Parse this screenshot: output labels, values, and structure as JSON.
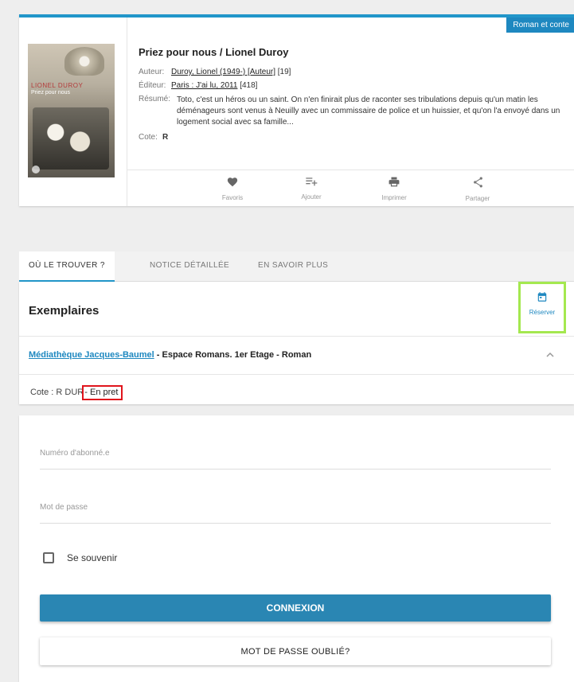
{
  "notice": {
    "genre_tag": "Roman et conte",
    "cover": {
      "author": "LIONEL DUROY",
      "title": "Priez pour nous"
    },
    "title": "Priez pour nous / Lionel Duroy",
    "author_label": "Auteur:",
    "author_value": "Duroy, Lionel (1949-) [Auteur]",
    "author_suffix": " [19]",
    "publisher_label": "Éditeur:",
    "publisher_value": "Paris : J'ai lu, 2011",
    "publisher_suffix": " [418]",
    "summary_label": "Résumé:",
    "summary": "Toto, c'est un héros ou un saint. On n'en finirait plus de raconter ses tribulations depuis qu'un matin les déménageurs sont venus à Neuilly avec un commissaire de police et un huissier, et qu'on l'a envoyé dans un logement social avec sa famille...",
    "cote_label": "Cote:",
    "cote_value": "R",
    "actions": {
      "favorite": "Favoris",
      "add": "Ajouter",
      "print": "Imprimer",
      "share": "Partager"
    }
  },
  "tabs": [
    "OÙ LE TROUVER ?",
    "NOTICE DÉTAILLÉE",
    "EN SAVOIR PLUS"
  ],
  "copies": {
    "title": "Exemplaires",
    "reserve_label": "Réserver",
    "library_link": "Médiathèque Jacques-Baumel",
    "location_rest": " - Espace Romans. 1er Etage - Roman",
    "cote_label": "Cote :",
    "cote_value": "R DUR",
    "status": "- En pret"
  },
  "login": {
    "subscriber_placeholder": "Numéro d'abonné.e",
    "password_placeholder": "Mot de passe",
    "remember_label": "Se souvenir",
    "connect_label": "CONNEXION",
    "forgot_label": "MOT DE PASSE OUBLIÉ?"
  },
  "colors": {
    "accent": "#2196c9",
    "button": "#2a86b3",
    "highlight_status": "#e0141c",
    "highlight_reserve": "#a4e84f"
  }
}
